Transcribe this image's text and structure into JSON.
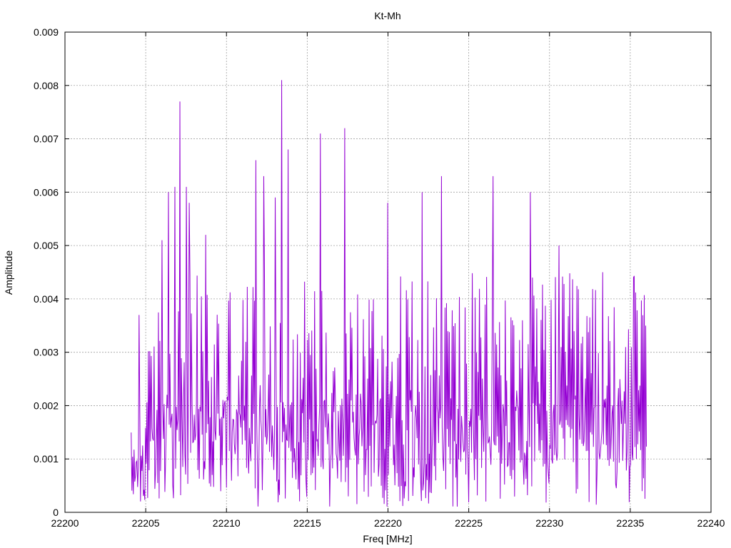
{
  "chart_data": {
    "type": "line",
    "title": "Kt-Mh",
    "xlabel": "Freq [MHz]",
    "ylabel": "Amplitude",
    "xlim": [
      22200,
      22240
    ],
    "ylim": [
      0,
      0.009
    ],
    "xticks": [
      22200,
      22205,
      22210,
      22215,
      22220,
      22225,
      22230,
      22235,
      22240
    ],
    "yticks": [
      "0",
      "0.001",
      "0.002",
      "0.003",
      "0.004",
      "0.005",
      "0.006",
      "0.007",
      "0.008",
      "0.009"
    ],
    "grid": true,
    "series": [
      {
        "color": "#9400d3",
        "x_start": 22204.1,
        "x_end": 22236.0,
        "sample_count": 720,
        "peaks": [
          {
            "x": 22204.6,
            "y": 0.0037
          },
          {
            "x": 22206.0,
            "y": 0.0051
          },
          {
            "x": 22206.4,
            "y": 0.006
          },
          {
            "x": 22206.8,
            "y": 0.0061
          },
          {
            "x": 22207.1,
            "y": 0.0077
          },
          {
            "x": 22207.5,
            "y": 0.0061
          },
          {
            "x": 22207.7,
            "y": 0.0058
          },
          {
            "x": 22208.7,
            "y": 0.0052
          },
          {
            "x": 22211.8,
            "y": 0.0066
          },
          {
            "x": 22212.3,
            "y": 0.0063
          },
          {
            "x": 22213.0,
            "y": 0.0059
          },
          {
            "x": 22213.4,
            "y": 0.0081
          },
          {
            "x": 22213.8,
            "y": 0.0068
          },
          {
            "x": 22215.8,
            "y": 0.0071
          },
          {
            "x": 22217.3,
            "y": 0.0072
          },
          {
            "x": 22220.0,
            "y": 0.0058
          },
          {
            "x": 22222.1,
            "y": 0.006
          },
          {
            "x": 22223.3,
            "y": 0.0063
          },
          {
            "x": 22226.5,
            "y": 0.0063
          },
          {
            "x": 22228.8,
            "y": 0.006
          },
          {
            "x": 22230.6,
            "y": 0.005
          },
          {
            "x": 22233.3,
            "y": 0.0045
          },
          {
            "x": 22235.2,
            "y": 0.0044
          }
        ],
        "typical_range": [
          0.0005,
          0.0045
        ]
      }
    ]
  }
}
